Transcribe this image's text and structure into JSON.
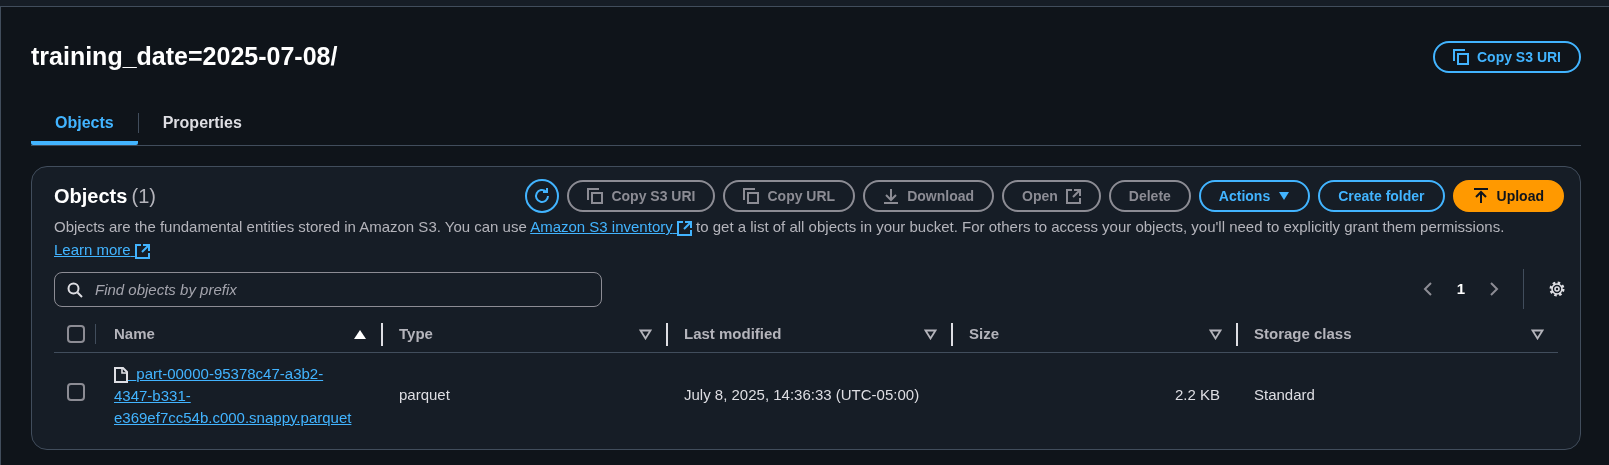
{
  "header": {
    "title": "training_date=2025-07-08/",
    "copy_button": "Copy S3 URI"
  },
  "tabs": [
    {
      "label": "Objects",
      "selected": true
    },
    {
      "label": "Properties",
      "selected": false
    }
  ],
  "objects_panel": {
    "title": "Objects",
    "count": "(1)",
    "buttons": [
      {
        "kind": "refresh",
        "disabled": false
      },
      {
        "kind": "copy",
        "label": "Copy S3 URI",
        "disabled": true
      },
      {
        "kind": "copy",
        "label": "Copy URL",
        "disabled": true
      },
      {
        "kind": "download",
        "label": "Download",
        "disabled": true
      },
      {
        "kind": "external",
        "label": "Open",
        "disabled": true
      },
      {
        "kind": "plain",
        "label": "Delete",
        "disabled": true
      },
      {
        "kind": "dropdown",
        "label": "Actions",
        "disabled": false
      },
      {
        "kind": "plain",
        "label": "Create folder",
        "disabled": false
      },
      {
        "kind": "primary",
        "label": "Upload",
        "disabled": false
      }
    ],
    "description": {
      "before": "Objects are the fundamental entities stored in Amazon S3. You can use",
      "link1": "Amazon S3 inventory",
      "middle": "to get a list of all objects in your bucket. For others to access your objects, you'll need to explicitly grant them permissions.",
      "link2": "Learn more"
    },
    "search": {
      "placeholder": "Find objects by prefix"
    },
    "pagination": {
      "page": "1"
    },
    "select_all": {
      "checked": false
    },
    "columns": [
      {
        "label": "Name",
        "sorted": true
      },
      {
        "label": "Type",
        "sorted": false
      },
      {
        "label": "Last modified",
        "sorted": false
      },
      {
        "label": "Size",
        "sorted": false
      },
      {
        "label": "Storage class",
        "sorted": false
      }
    ],
    "rows": [
      {
        "checked": false,
        "name": "part-00000-95378c47-a3b2-4347-b331-e369ef7cc54b.c000.snappy.parquet",
        "type": "parquet",
        "last_modified": "July 8, 2025, 14:36:33 (UTC-05:00)",
        "size": "2.2 KB",
        "storage_class": "Standard"
      }
    ]
  }
}
